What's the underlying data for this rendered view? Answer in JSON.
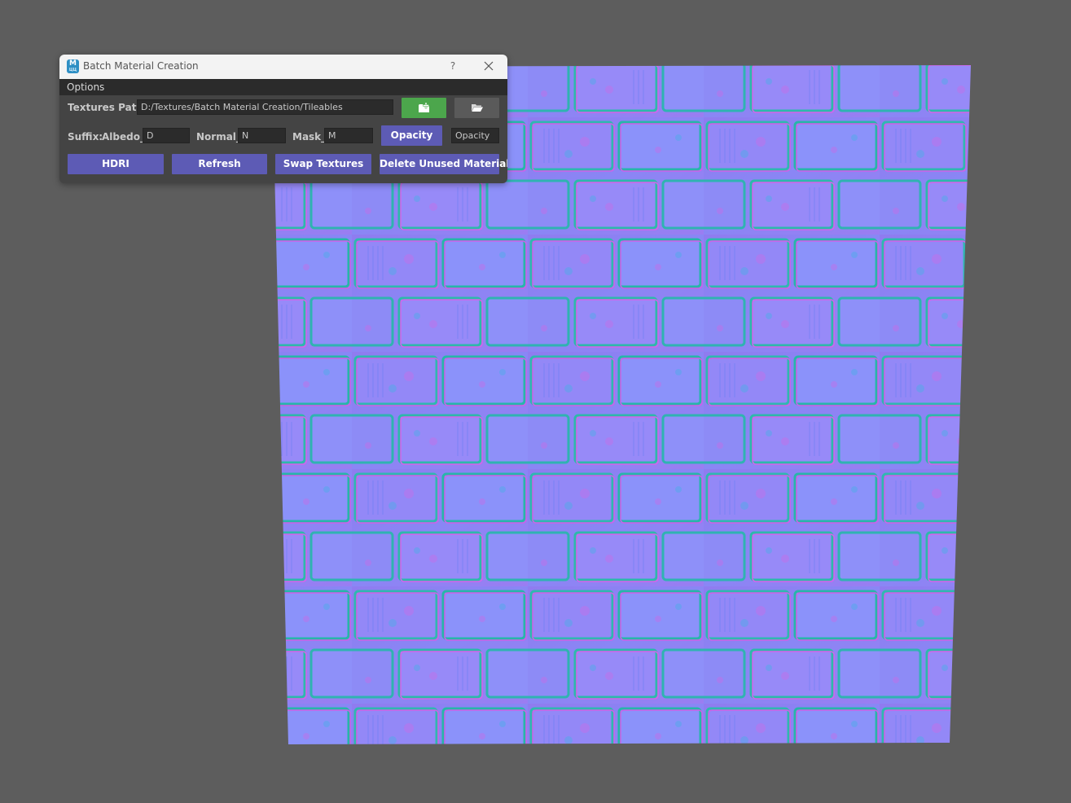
{
  "window": {
    "title": "Batch Material Creation",
    "help_label": "?",
    "app_icon_letter": "M",
    "app_icon_sub": "ЦЦ"
  },
  "menu": {
    "options_label": "Options"
  },
  "textures": {
    "path_label": "Textures Path:",
    "path_value": "D:/Textures/Batch Material Creation/Tileables",
    "add_folder_icon": "folder-add-icon",
    "browse_icon": "folder-open-icon"
  },
  "suffix": {
    "label": "Suffix:",
    "albedo_label": "Albedo_",
    "albedo_value": "D",
    "normal_label": "Normal_",
    "normal_value": "N",
    "mask_label": "Mask_",
    "mask_value": "M",
    "opacity_button": "Opacity",
    "opacity_value": "Opacity"
  },
  "actions": {
    "hdri": "HDRI",
    "refresh": "Refresh",
    "swap": "Swap Textures",
    "delete_unused": "Delete Unused Materials"
  },
  "colors": {
    "viewport_bg": "#5d5d5d",
    "dialog_bg": "#444444",
    "button_purple": "#5d5bb5",
    "button_green": "#4ca64c",
    "button_gray": "#5a5a5a"
  }
}
